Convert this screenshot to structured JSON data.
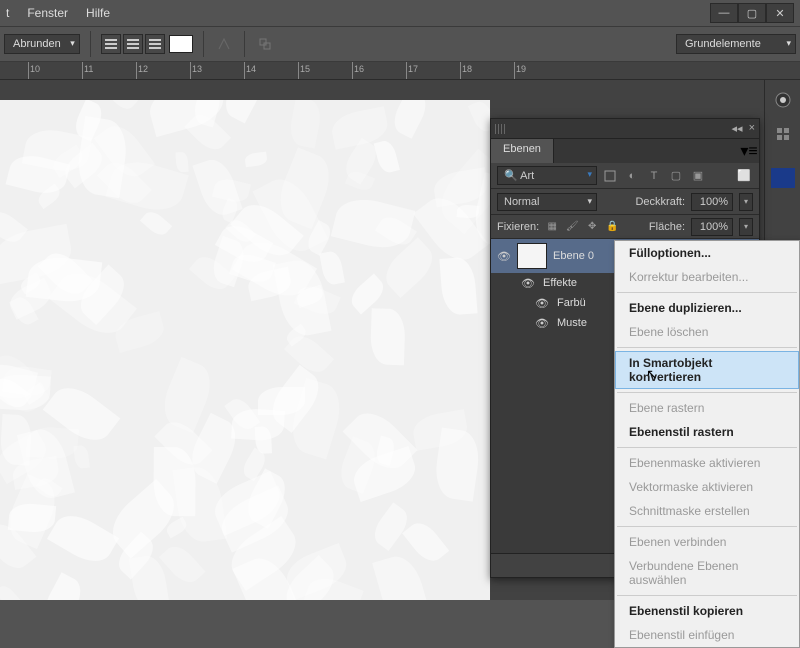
{
  "menubar": {
    "items": [
      "",
      "Fenster",
      "Hilfe"
    ]
  },
  "toolbar": {
    "dropdown_left": "Abrunden",
    "dropdown_right": "Grundelemente"
  },
  "ruler": {
    "start": 10,
    "end": 19
  },
  "layers": {
    "title": "Ebenen",
    "filter_label": "Art",
    "blend_mode": "Normal",
    "opacity_label": "Deckkraft:",
    "opacity_value": "100%",
    "fill_label": "Fläche:",
    "fill_value": "100%",
    "lock_label": "Fixieren:",
    "layer_name": "Ebene 0",
    "effects_label": "Effekte",
    "effect1": "Farbü",
    "effect2": "Muste"
  },
  "context": {
    "items": [
      {
        "label": "Fülloptionen...",
        "bold": true,
        "disabled": false
      },
      {
        "label": "Korrektur bearbeiten...",
        "disabled": true
      },
      {
        "sep": true
      },
      {
        "label": "Ebene duplizieren...",
        "bold": true,
        "disabled": false
      },
      {
        "label": "Ebene löschen",
        "disabled": true
      },
      {
        "sep": true
      },
      {
        "label": "In Smartobjekt konvertieren",
        "bold": true,
        "hover": true
      },
      {
        "sep": true
      },
      {
        "label": "Ebene rastern",
        "disabled": true
      },
      {
        "label": "Ebenenstil rastern",
        "bold": true
      },
      {
        "sep": true
      },
      {
        "label": "Ebenenmaske aktivieren",
        "disabled": true
      },
      {
        "label": "Vektormaske aktivieren",
        "disabled": true
      },
      {
        "label": "Schnittmaske erstellen",
        "disabled": true
      },
      {
        "sep": true
      },
      {
        "label": "Ebenen verbinden",
        "disabled": true
      },
      {
        "label": "Verbundene Ebenen auswählen",
        "disabled": true
      },
      {
        "sep": true
      },
      {
        "label": "Ebenenstil kopieren",
        "bold": true
      },
      {
        "label": "Ebenenstil einfügen",
        "disabled": true
      }
    ]
  }
}
